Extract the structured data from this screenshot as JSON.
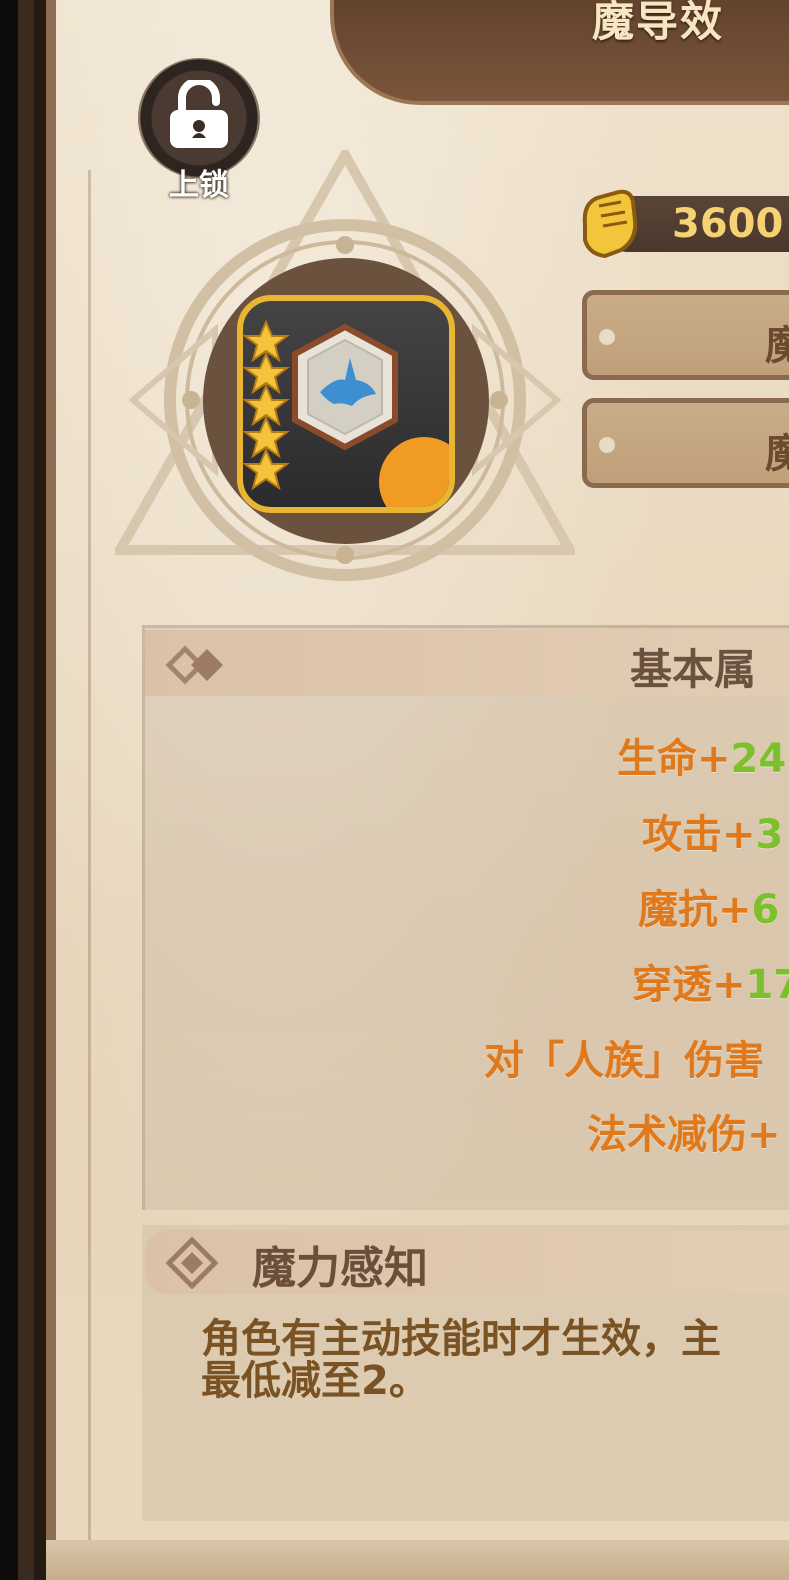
{
  "banner": {
    "title": "魔导效"
  },
  "lock": {
    "label": "上锁",
    "icon": "unlocked-padlock-icon"
  },
  "item": {
    "stars": 5,
    "star_color": "#f3c43a",
    "frame_color": "#e9b634",
    "gem_icon": "blue-creature-hexagon-gem"
  },
  "cost": {
    "value": "3600",
    "icon": "yellow-fist-icon",
    "color": "#f6d274"
  },
  "side_buttons": [
    {
      "label": "魔"
    },
    {
      "label": "魔"
    }
  ],
  "attributes": {
    "title": "基本属",
    "lines": [
      {
        "label": "生命+",
        "value": "24"
      },
      {
        "label": "攻击+",
        "value": "3"
      },
      {
        "label": "魔抗+",
        "value": "6"
      },
      {
        "label": "穿透+",
        "value": "17"
      },
      {
        "label": "对「人族」伤害",
        "value": ""
      },
      {
        "label": "法术减伤+",
        "value": ""
      }
    ]
  },
  "skill": {
    "title": "魔力感知",
    "description_line1": "角色有主动技能时才生效，主",
    "description_line2": "最低减至2。"
  }
}
